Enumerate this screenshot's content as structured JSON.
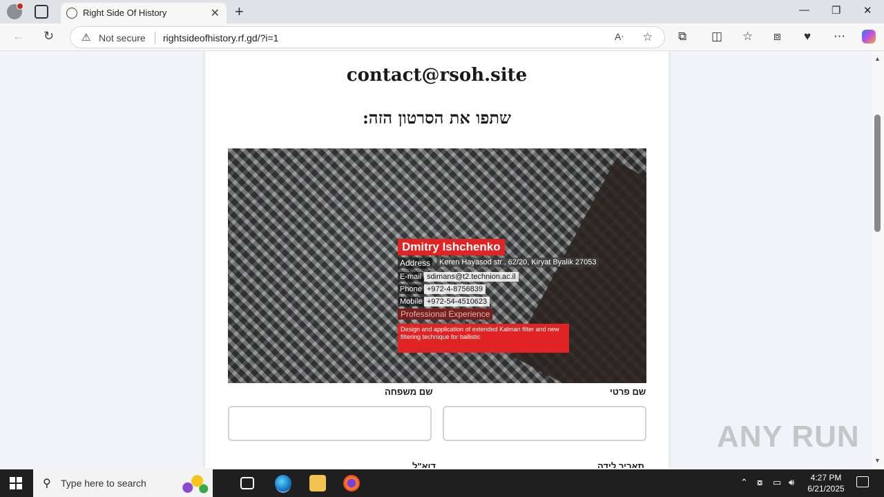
{
  "browser": {
    "tab_title": "Right Side Of History",
    "close_tab": "✕",
    "new_tab": "+",
    "security_label": "Not secure",
    "url": "rightsideofhistory.rf.gd/?i=1",
    "read_aloud": "A̩",
    "window": {
      "minimize": "—",
      "restore": "❐",
      "close": "✕"
    }
  },
  "page": {
    "contact_email": "contact@rsoh.site",
    "share_heading": "שתפו את הסרטון הזה:",
    "video_card": {
      "name": "Dmitry Ishchenko",
      "address_label": "Address",
      "address_value": "Keren Hayasod str., 62/20, Kiryat Byalik 27053",
      "email_label": "E-mail",
      "email_value": "sdimans@t2.technion.ac.il",
      "phone_label": "Phone",
      "phone_value": "+972-4-8756839",
      "mobile_label": "Mobile",
      "mobile_value": "+972-54-4510623",
      "experience_label": "Professional Experience",
      "experience_desc": "Design and application of extended Kalman filter and new filtering  technique  for  ballistic"
    },
    "form": {
      "first_name_label": "שם פרטי",
      "last_name_label": "שם משפחה",
      "next_label_right": "תאריך לידה",
      "next_label_left": "דוא\"ל"
    }
  },
  "watermark": "ANY RUN",
  "taskbar": {
    "search_placeholder": "Type here to search",
    "time": "4:27 PM",
    "date": "6/21/2025"
  },
  "colors": {
    "accent_red": "#e02424",
    "taskbar": "#1f1f1f"
  }
}
